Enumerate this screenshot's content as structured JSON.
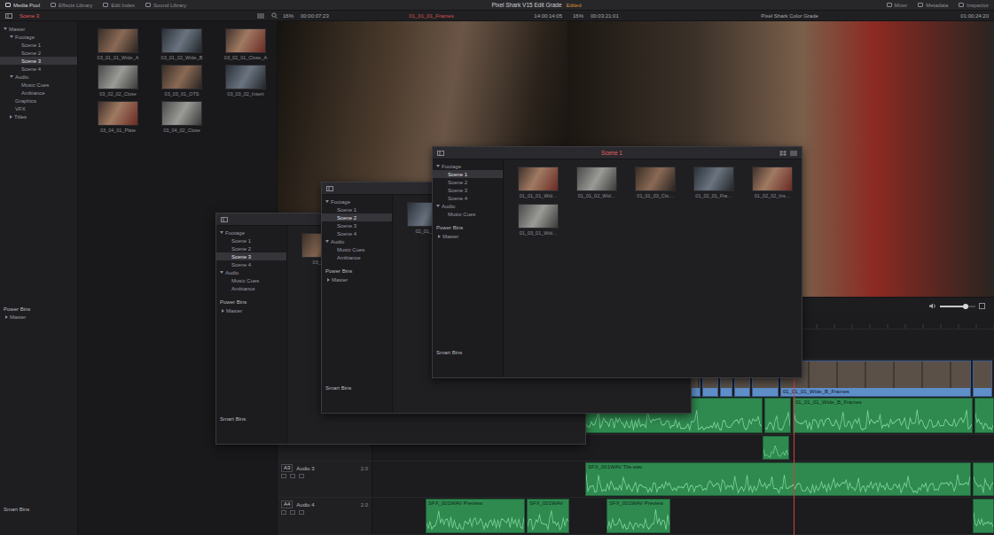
{
  "top_bar": {
    "left_tabs": [
      {
        "label": "Media Pool",
        "selected": true
      },
      {
        "label": "Effects Library",
        "selected": false
      },
      {
        "label": "Edit Index",
        "selected": false
      },
      {
        "label": "Sound Library",
        "selected": false
      }
    ],
    "title": "Pixel Shark V15 Edit Grade",
    "status": "Edited",
    "right_tabs": [
      {
        "label": "Mixer",
        "selected": false
      },
      {
        "label": "Metadata",
        "selected": false
      },
      {
        "label": "Inspector",
        "selected": false
      }
    ]
  },
  "toolbar": {
    "bin": "Scene 3",
    "source_zoom": "16%",
    "source_timecode": "00:00:07:23",
    "source_clip": "01_01_01_Frames",
    "source_duration": "14:00:14:05",
    "timeline_zoom": "16%",
    "timeline_duration": "00:03:21:01",
    "timeline_name": "Pixel Shark Color Grade",
    "timeline_timecode": "01:00:24:20"
  },
  "sidebar": {
    "items": [
      {
        "label": "Master",
        "depth": 0,
        "kind": "group",
        "expanded": true,
        "selected": false
      },
      {
        "label": "Footage",
        "depth": 1,
        "kind": "group",
        "expanded": true,
        "selected": false
      },
      {
        "label": "Scene 1",
        "depth": 2,
        "kind": "bin",
        "expanded": false,
        "selected": false
      },
      {
        "label": "Scene 2",
        "depth": 2,
        "kind": "bin",
        "expanded": false,
        "selected": false
      },
      {
        "label": "Scene 3",
        "depth": 2,
        "kind": "bin",
        "expanded": false,
        "selected": true
      },
      {
        "label": "Scene 4",
        "depth": 2,
        "kind": "bin",
        "expanded": false,
        "selected": false
      },
      {
        "label": "Audio",
        "depth": 1,
        "kind": "group",
        "expanded": true,
        "selected": false
      },
      {
        "label": "Music Cues",
        "depth": 2,
        "kind": "bin",
        "expanded": false,
        "selected": false
      },
      {
        "label": "Ambiance",
        "depth": 2,
        "kind": "bin",
        "expanded": false,
        "selected": false
      },
      {
        "label": "Graphics",
        "depth": 1,
        "kind": "bin",
        "expanded": false,
        "selected": false
      },
      {
        "label": "VFX",
        "depth": 1,
        "kind": "bin",
        "expanded": false,
        "selected": false
      },
      {
        "label": "Titles",
        "depth": 1,
        "kind": "group",
        "expanded": false,
        "selected": false
      }
    ],
    "power_bins_label": "Power Bins",
    "power_bins": [
      "Master"
    ],
    "smart_bins_label": "Smart Bins"
  },
  "clips": [
    "03_01_01_Wide_A",
    "03_01_02_Wide_B",
    "03_02_01_Close_A",
    "03_02_02_Close",
    "03_03_01_OTS",
    "03_03_02_Insert",
    "03_04_01_Plate",
    "03_04_02_Close"
  ],
  "bin_windows": [
    {
      "title": "Scene 3",
      "active": false,
      "items": [
        {
          "label": "Footage",
          "depth": 0,
          "kind": "group",
          "expanded": true,
          "selected": false
        },
        {
          "label": "Scene 1",
          "depth": 1,
          "kind": "bin",
          "expanded": false,
          "selected": false
        },
        {
          "label": "Scene 2",
          "depth": 1,
          "kind": "bin",
          "expanded": false,
          "selected": false
        },
        {
          "label": "Scene 3",
          "depth": 1,
          "kind": "bin",
          "expanded": false,
          "selected": true
        },
        {
          "label": "Scene 4",
          "depth": 1,
          "kind": "bin",
          "expanded": false,
          "selected": false
        },
        {
          "label": "Audio",
          "depth": 0,
          "kind": "group",
          "expanded": true,
          "selected": false
        },
        {
          "label": "Music Cues",
          "depth": 1,
          "kind": "bin",
          "expanded": false,
          "selected": false
        },
        {
          "label": "Ambiance",
          "depth": 1,
          "kind": "bin",
          "expanded": false,
          "selected": false
        }
      ],
      "power_bins_label": "Power Bins",
      "power_bins": [
        "Master"
      ],
      "smart_bins_label": "Smart Bins",
      "clips": [
        "03_01…"
      ]
    },
    {
      "title": "Scene 2",
      "active": false,
      "items": [
        {
          "label": "Footage",
          "depth": 0,
          "kind": "group",
          "expanded": true,
          "selected": false
        },
        {
          "label": "Scene 1",
          "depth": 1,
          "kind": "bin",
          "expanded": false,
          "selected": false
        },
        {
          "label": "Scene 2",
          "depth": 1,
          "kind": "bin",
          "expanded": false,
          "selected": true
        },
        {
          "label": "Scene 3",
          "depth": 1,
          "kind": "bin",
          "expanded": false,
          "selected": false
        },
        {
          "label": "Scene 4",
          "depth": 1,
          "kind": "bin",
          "expanded": false,
          "selected": false
        },
        {
          "label": "Audio",
          "depth": 0,
          "kind": "group",
          "expanded": true,
          "selected": false
        },
        {
          "label": "Music Cues",
          "depth": 1,
          "kind": "bin",
          "expanded": false,
          "selected": false
        },
        {
          "label": "Ambiance",
          "depth": 1,
          "kind": "bin",
          "expanded": false,
          "selected": false
        }
      ],
      "power_bins_label": "Power Bins",
      "power_bins": [
        "Master"
      ],
      "smart_bins_label": "Smart Bins",
      "clips": [
        "02_01_0…"
      ]
    },
    {
      "title": "Scene 1",
      "active": true,
      "items": [
        {
          "label": "Footage",
          "depth": 0,
          "kind": "group",
          "expanded": true,
          "selected": false
        },
        {
          "label": "Scene 1",
          "depth": 1,
          "kind": "bin",
          "expanded": false,
          "selected": true
        },
        {
          "label": "Scene 2",
          "depth": 1,
          "kind": "bin",
          "expanded": false,
          "selected": false
        },
        {
          "label": "Scene 3",
          "depth": 1,
          "kind": "bin",
          "expanded": false,
          "selected": false
        },
        {
          "label": "Scene 4",
          "depth": 1,
          "kind": "bin",
          "expanded": false,
          "selected": false
        },
        {
          "label": "Audio",
          "depth": 0,
          "kind": "group",
          "expanded": true,
          "selected": false
        },
        {
          "label": "Music Cues",
          "depth": 1,
          "kind": "bin",
          "expanded": false,
          "selected": false
        }
      ],
      "power_bins_label": "Power Bins",
      "power_bins": [
        "Master"
      ],
      "smart_bins_label": "Smart Bins",
      "clips": [
        "01_01_01_Wid…",
        "01_01_02_Wid…",
        "01_01_03_Clo…",
        "01_02_01_Fra…",
        "01_02_02_Ins…",
        "01_03_01_Wid…"
      ]
    }
  ],
  "transport": [
    "⏮",
    "◀",
    "■",
    "▶",
    "⏭",
    "⟲"
  ],
  "volume": {
    "level": 0.72
  },
  "timeline": {
    "tracks": [
      {
        "kind": "empty",
        "clips": []
      },
      {
        "kind": "video",
        "clips": [
          {},
          {},
          {},
          {},
          {},
          {
            "label": "01_01_01_Wide_B_Frames"
          },
          {}
        ]
      },
      {
        "kind": "audio",
        "clips": [
          {},
          {},
          {
            "label": "01_01_01_Wide_B_Frames"
          },
          {}
        ]
      },
      {
        "kind": "audio",
        "clips": [
          {}
        ]
      },
      {
        "kind": "audio",
        "id": "A3",
        "name": "Audio 3",
        "channels": "2.0",
        "clips": [
          {
            "label": "SFX_001WAV Tile.wav"
          },
          {}
        ]
      },
      {
        "kind": "audio",
        "id": "A4",
        "name": "Audio 4",
        "channels": "2.0",
        "clips": [
          {
            "label": "SFX_001WAV Preview"
          },
          {
            "label": "SFX_001WAV"
          },
          {
            "label": "SFX_001WAV Preview"
          },
          {}
        ]
      }
    ]
  }
}
